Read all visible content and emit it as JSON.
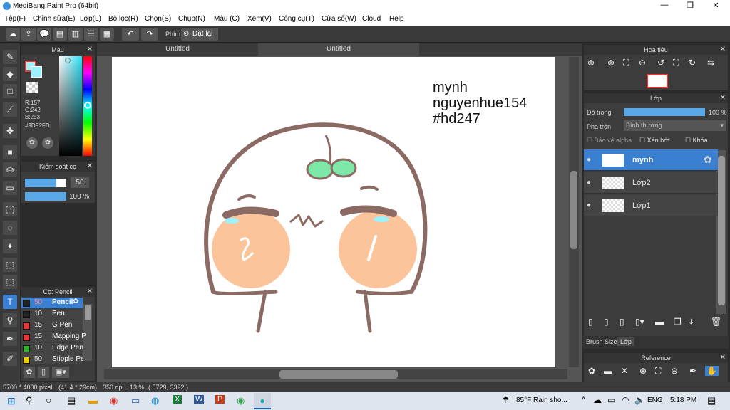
{
  "app": {
    "title": "MediBang Paint Pro (64bit)",
    "min": "—",
    "max": "❐",
    "close": "✕"
  },
  "menu": [
    "Tệp(F)",
    "Chỉnh sửa(E)",
    "Lớp(L)",
    "Bộ lọc(R)",
    "Chọn(S)",
    "Chụp(N)",
    "Màu (C)",
    "Xem(V)",
    "Công cụ(T)",
    "Cửa sổ(W)",
    "Cloud",
    "Help"
  ],
  "toolbar": {
    "phim": "Phím",
    "reset": "Đặt lại"
  },
  "color_panel": {
    "title": "Màu",
    "r": "R:157",
    "g": "G:242",
    "b": "B:253",
    "hex": "#9DF2FD",
    "fg": "#9DF2FD"
  },
  "control_panel": {
    "title": "Kiểm soát cọ",
    "size": "50",
    "opacity": "100 %",
    "opacity_value": 100
  },
  "brush_panel": {
    "title": "Cọ: Pencil",
    "items": [
      {
        "size": "50",
        "name": "Pencil",
        "color": "#222222"
      },
      {
        "size": "10",
        "name": "Pen",
        "color": "#222222"
      },
      {
        "size": "15",
        "name": "G Pen",
        "color": "#e53935"
      },
      {
        "size": "15",
        "name": "Mapping P",
        "color": "#e53935"
      },
      {
        "size": "10",
        "name": "Edge Pen",
        "color": "#2db52d"
      },
      {
        "size": "50",
        "name": "Stipple Pe",
        "color": "#f0d000"
      }
    ]
  },
  "tabs": [
    "Untitled",
    "Untitled"
  ],
  "canvas_text": {
    "line1": "mynh",
    "line2": "nguyenhue154",
    "line3": "#hd247"
  },
  "navigator": {
    "title": "Hoa tiêu"
  },
  "layer_panel": {
    "title": "Lớp",
    "opacity_label": "Độ trong",
    "opacity": "100 %",
    "blend_label": "Pha trộn",
    "blend": "Bình thường",
    "protect": "Bảo vệ alpha",
    "clip": "Xén bớt",
    "lock": "Khóa",
    "layers": [
      {
        "name": "mynh",
        "selected": true
      },
      {
        "name": "Lớp2",
        "selected": false
      },
      {
        "name": "Lớp1",
        "selected": false
      }
    ]
  },
  "bottom_tabs": {
    "brush_size": "Brush Size",
    "layer": "Lớp"
  },
  "reference": {
    "title": "Reference"
  },
  "status": {
    "size": "5700 * 4000 pixel",
    "cm": "(41.4 * 29cm)",
    "dpi": "350 dpi",
    "zoom": "13 %",
    "coords": "( 5729, 3322 )"
  },
  "taskbar": {
    "weather": "85°F  Rain sho...",
    "lang": "ENG",
    "time": "5:18 PM"
  }
}
